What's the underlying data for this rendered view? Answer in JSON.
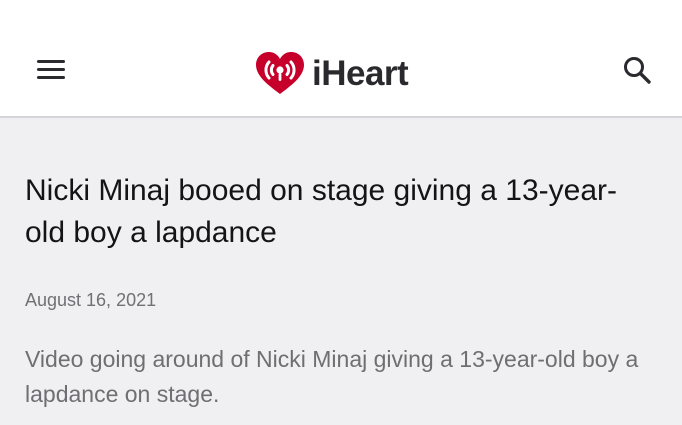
{
  "header": {
    "logo_text": "iHeart",
    "menu_icon": "hamburger-menu-icon",
    "search_icon": "search-icon",
    "logo_icon": "iheart-logo-icon"
  },
  "article": {
    "title": "Nicki Minaj booed on stage giving a 13-year-old boy a lapdance",
    "date": "August 16, 2021",
    "description": "Video going around of Nicki Minaj giving a 13-year-old boy a lapdance on stage."
  },
  "colors": {
    "brand_red": "#c6002b",
    "header_bg": "#ffffff",
    "page_bg": "#f0f0f3",
    "title_text": "#141416",
    "muted_text": "#6e6e73"
  }
}
